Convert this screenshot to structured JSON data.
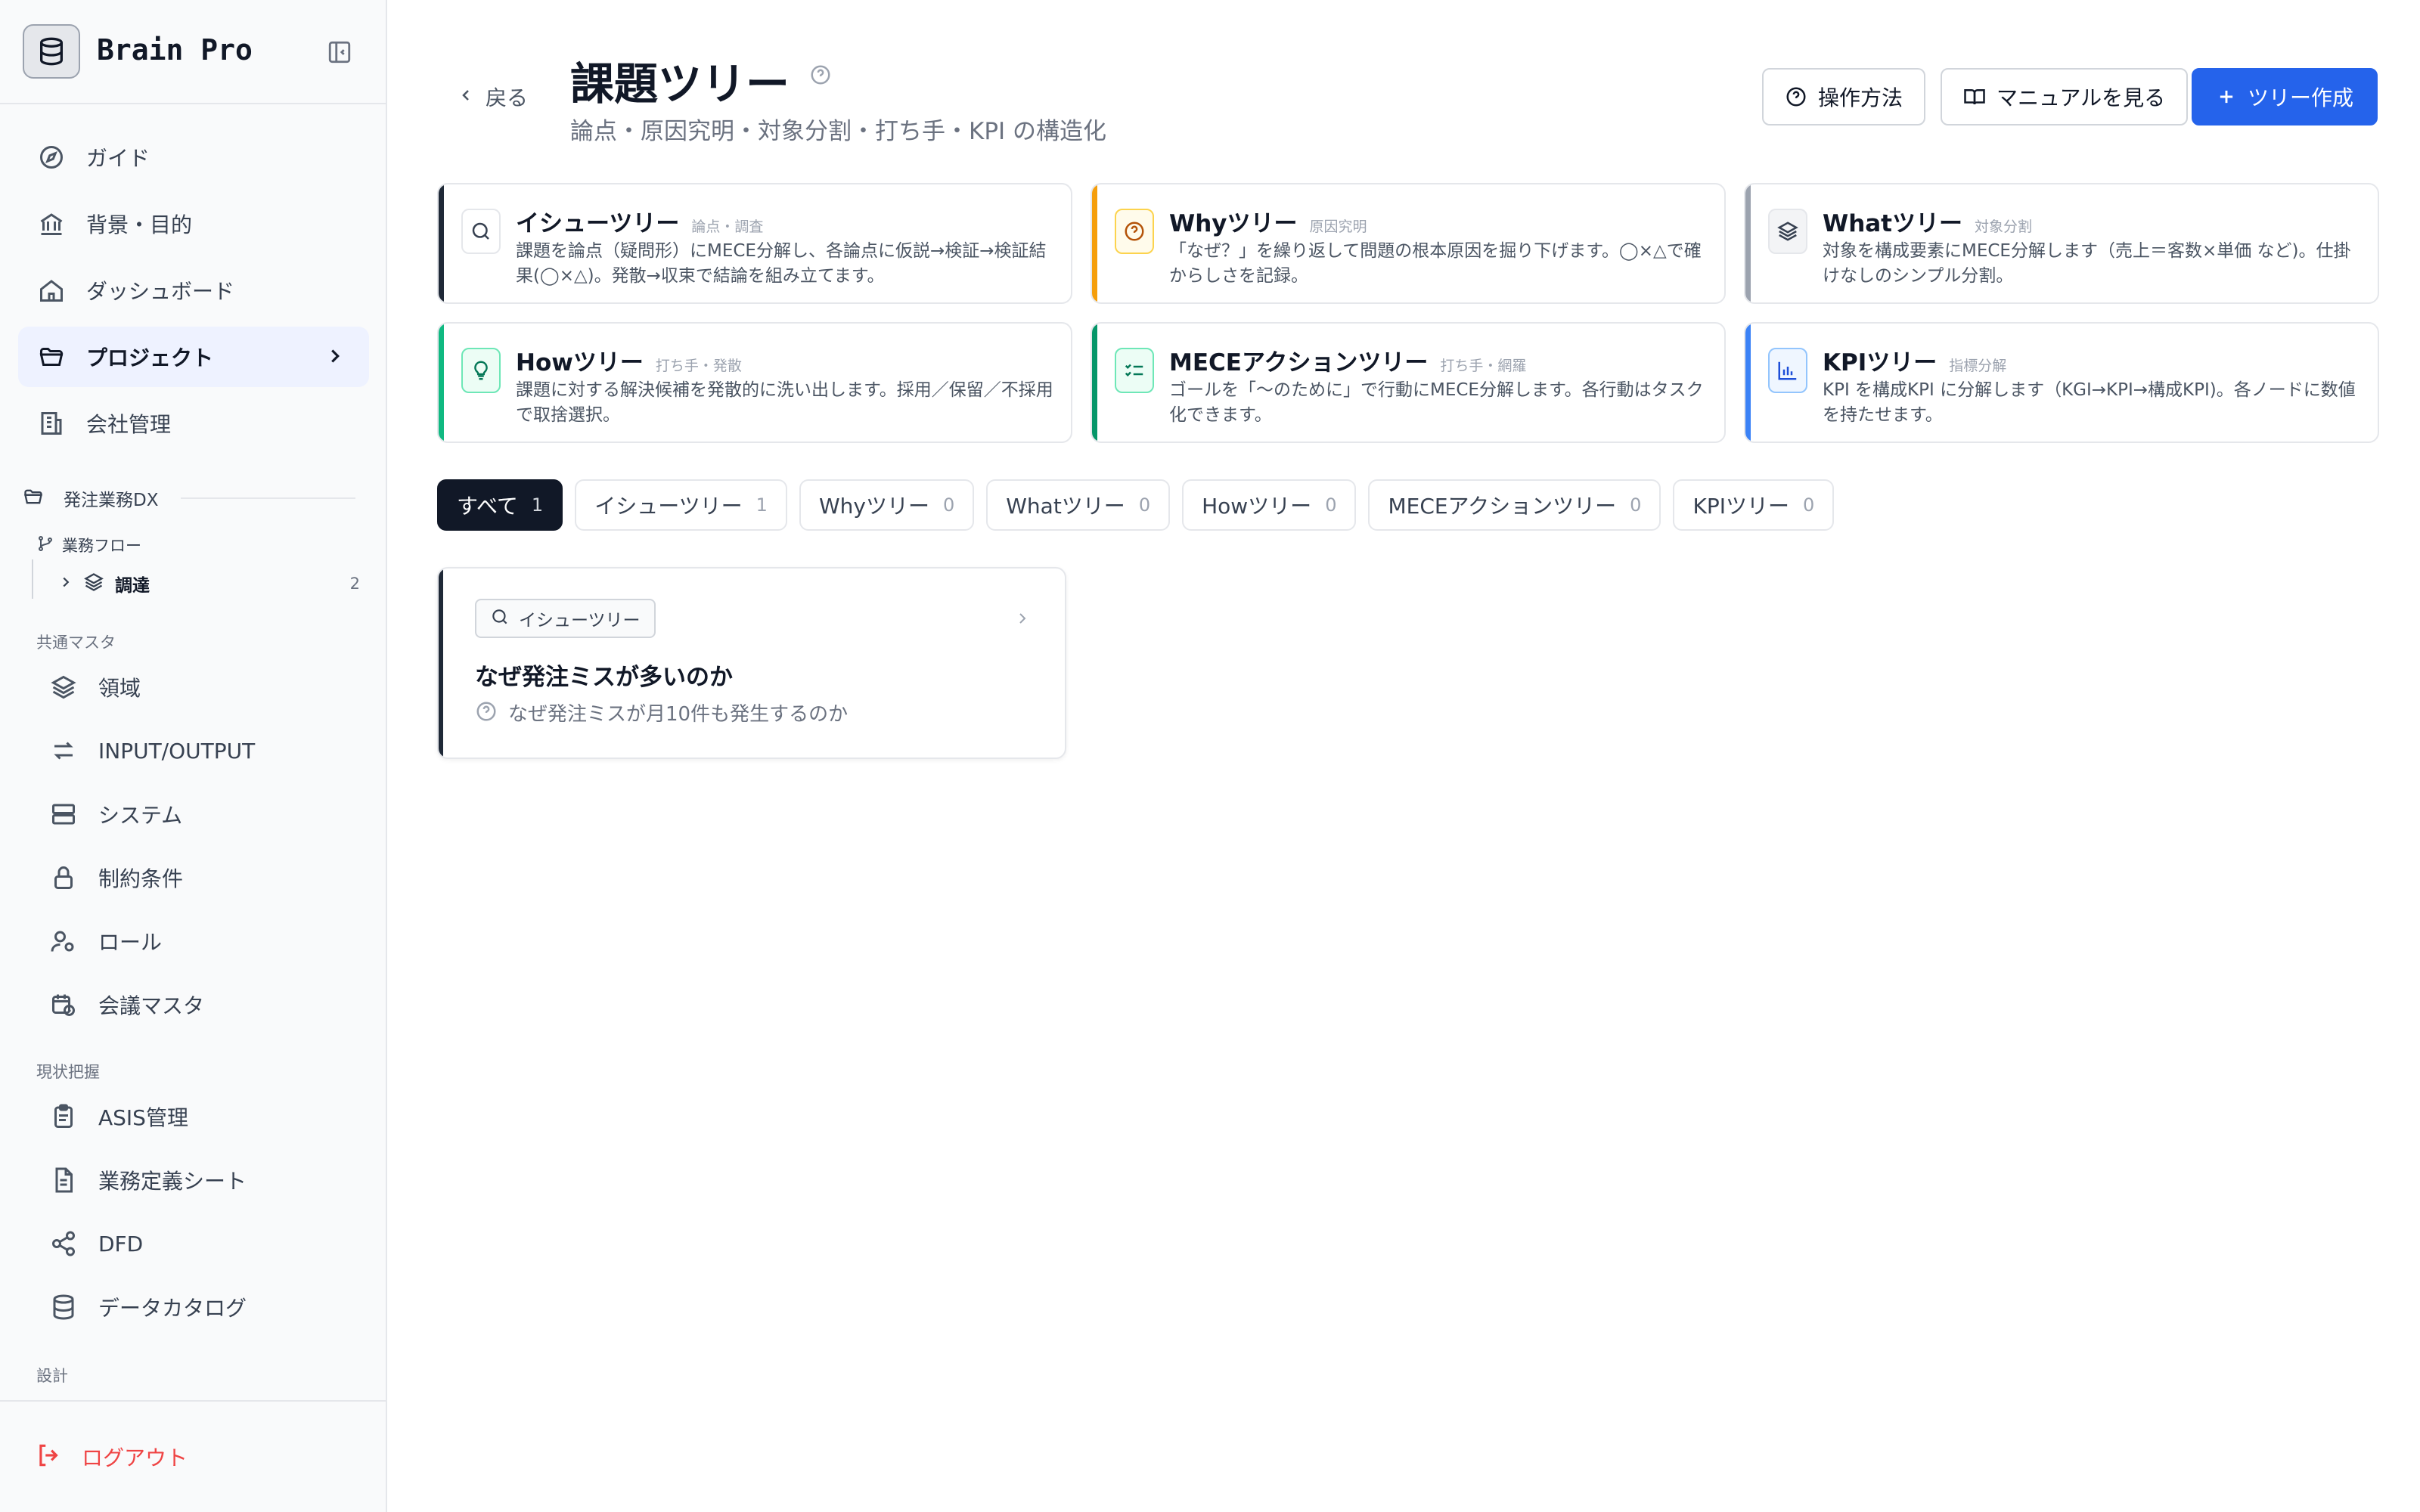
{
  "app": {
    "name": "Brain Pro"
  },
  "sidebar": {
    "nav": [
      {
        "label": "ガイド",
        "icon": "compass-icon"
      },
      {
        "label": "背景・目的",
        "icon": "bank-icon"
      },
      {
        "label": "ダッシュボード",
        "icon": "home-icon"
      },
      {
        "label": "プロジェクト",
        "icon": "folder-open-icon",
        "active": true
      },
      {
        "label": "会社管理",
        "icon": "building-icon"
      }
    ],
    "project": {
      "name": "発注業務DX"
    },
    "flow": {
      "title": "業務フロー",
      "item": {
        "label": "調達",
        "count": "2"
      }
    },
    "groups": {
      "common_master": "共通マスタ",
      "current_state": "現状把握",
      "design": "設計"
    },
    "common_items": [
      {
        "label": "領域",
        "icon": "layers-icon"
      },
      {
        "label": "INPUT/OUTPUT",
        "icon": "arrows-icon"
      },
      {
        "label": "システム",
        "icon": "server-icon"
      },
      {
        "label": "制約条件",
        "icon": "lock-icon"
      },
      {
        "label": "ロール",
        "icon": "user-cog-icon"
      },
      {
        "label": "会議マスタ",
        "icon": "calendar-clock-icon"
      }
    ],
    "current_items": [
      {
        "label": "ASIS管理",
        "icon": "clipboard-icon"
      },
      {
        "label": "業務定義シート",
        "icon": "file-sheet-icon"
      },
      {
        "label": "DFD",
        "icon": "share-icon"
      },
      {
        "label": "データカタログ",
        "icon": "database-icon"
      }
    ],
    "logout": "ログアウト"
  },
  "header": {
    "back": "戻る",
    "title": "課題ツリー",
    "subtitle": "論点・原因究明・対象分割・打ち手・KPI の構造化",
    "buttons": {
      "howto": "操作方法",
      "manual": "マニュアルを見る",
      "create": "ツリー作成"
    }
  },
  "tree_types": [
    {
      "name": "イシューツリー",
      "tag": "論点・調査",
      "desc": "課題を論点（疑問形）にMECE分解し、各論点に仮説→検証→検証結果(◯×△)。発散→収束で結論を組み立てます。",
      "color": "#1f2937",
      "icon": "search-icon"
    },
    {
      "name": "Whyツリー",
      "tag": "原因究明",
      "desc": "「なぜ？」を繰り返して問題の根本原因を掘り下げます。◯×△で確からしさを記録。",
      "color": "#f59e0b",
      "icon": "question-circle-icon"
    },
    {
      "name": "Whatツリー",
      "tag": "対象分割",
      "desc": "対象を構成要素にMECE分解します（売上＝客数×単価 など)。仕掛けなしのシンプル分割。",
      "color": "#9ca3af",
      "icon": "layers-icon"
    },
    {
      "name": "Howツリー",
      "tag": "打ち手・発散",
      "desc": "課題に対する解決候補を発散的に洗い出します。採用／保留／不採用で取捨選択。",
      "color": "#10b981",
      "icon": "lightbulb-icon"
    },
    {
      "name": "MECEアクションツリー",
      "tag": "打ち手・網羅",
      "desc": "ゴールを「〜のために」で行動にMECE分解します。各行動はタスク化できます。",
      "color": "#059669",
      "icon": "list-check-icon"
    },
    {
      "name": "KPIツリー",
      "tag": "指標分解",
      "desc": "KPI を構成KPI に分解します（KGI→KPI→構成KPI)。各ノードに数値を持たせます。",
      "color": "#3b82f6",
      "icon": "bar-chart-icon"
    }
  ],
  "filters": [
    {
      "label": "すべて",
      "count": "1",
      "active": true
    },
    {
      "label": "イシューツリー",
      "count": "1"
    },
    {
      "label": "Whyツリー",
      "count": "0"
    },
    {
      "label": "Whatツリー",
      "count": "0"
    },
    {
      "label": "Howツリー",
      "count": "0"
    },
    {
      "label": "MECEアクションツリー",
      "count": "0"
    },
    {
      "label": "KPIツリー",
      "count": "0"
    }
  ],
  "trees": [
    {
      "type": "イシューツリー",
      "title": "なぜ発注ミスが多いのか",
      "question": "なぜ発注ミスが月10件も発生するのか"
    }
  ],
  "colors": {
    "primary": "#2563eb",
    "danger": "#ef4444",
    "dark": "#111827"
  }
}
